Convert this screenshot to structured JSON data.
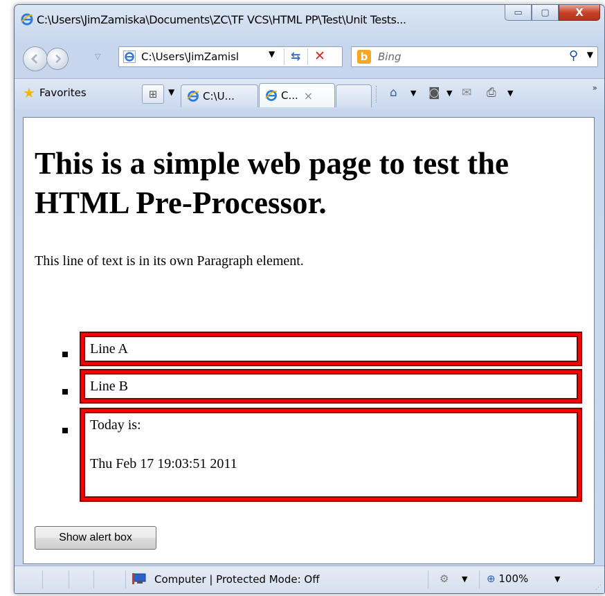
{
  "window": {
    "title": "C:\\Users\\JimZamiska\\Documents\\ZC\\TF VCS\\HTML PP\\Test\\Unit Tests...",
    "minimize_glyph": "▭",
    "maximize_glyph": "▢",
    "close_glyph": "X"
  },
  "nav": {
    "address": "C:\\Users\\JimZamisl",
    "search_placeholder": "Bing",
    "bing_letter": "b"
  },
  "tabs": {
    "favorites_label": "Favorites",
    "tab1_label": "C:\\U...",
    "tab2_label": "C...",
    "tab_close_glyph": "×"
  },
  "page": {
    "heading": "This is a simple web page to test the HTML Pre-Processor.",
    "paragraph": "This line of text is in its own Paragraph element.",
    "list_items": [
      {
        "label": "Line A"
      },
      {
        "label": "Line B"
      },
      {
        "label": "Today is:",
        "detail": "Thu Feb 17 19:03:51 2011"
      }
    ],
    "button_label": "Show alert box"
  },
  "status": {
    "zone_text": "Computer | Protected Mode: Off",
    "zoom_text": "100%"
  },
  "colors": {
    "list_border": "#ff0000",
    "list_border_dark": "#800000",
    "window_frame": "#c9d8ee",
    "close_button": "#c7432a"
  },
  "icons": [
    "ie-icon",
    "back-icon",
    "forward-icon",
    "refresh-icon",
    "stop-icon",
    "search-icon",
    "favorites-star-icon",
    "quick-tabs-icon",
    "home-icon",
    "feeds-icon",
    "mail-icon",
    "print-icon",
    "computer-icon",
    "zone-icon",
    "zoom-icon"
  ]
}
